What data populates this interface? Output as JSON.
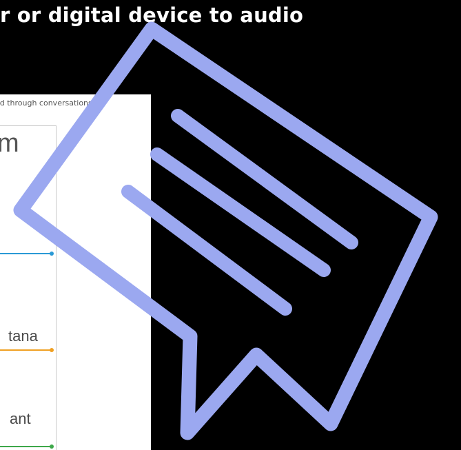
{
  "headline": {
    "text": "r or digital device to audio"
  },
  "slide": {
    "caption": "ned through conversations.",
    "heading_fragment": "m",
    "assistants": [
      {
        "label": "",
        "color": "#2a9ad6"
      },
      {
        "label": "tana",
        "color": "#f0a022"
      },
      {
        "label": "ant",
        "color": "#3ea84a"
      }
    ]
  },
  "overlay": {
    "icon": "chat-bubble-icon",
    "stroke_color": "#9ba8f0"
  }
}
